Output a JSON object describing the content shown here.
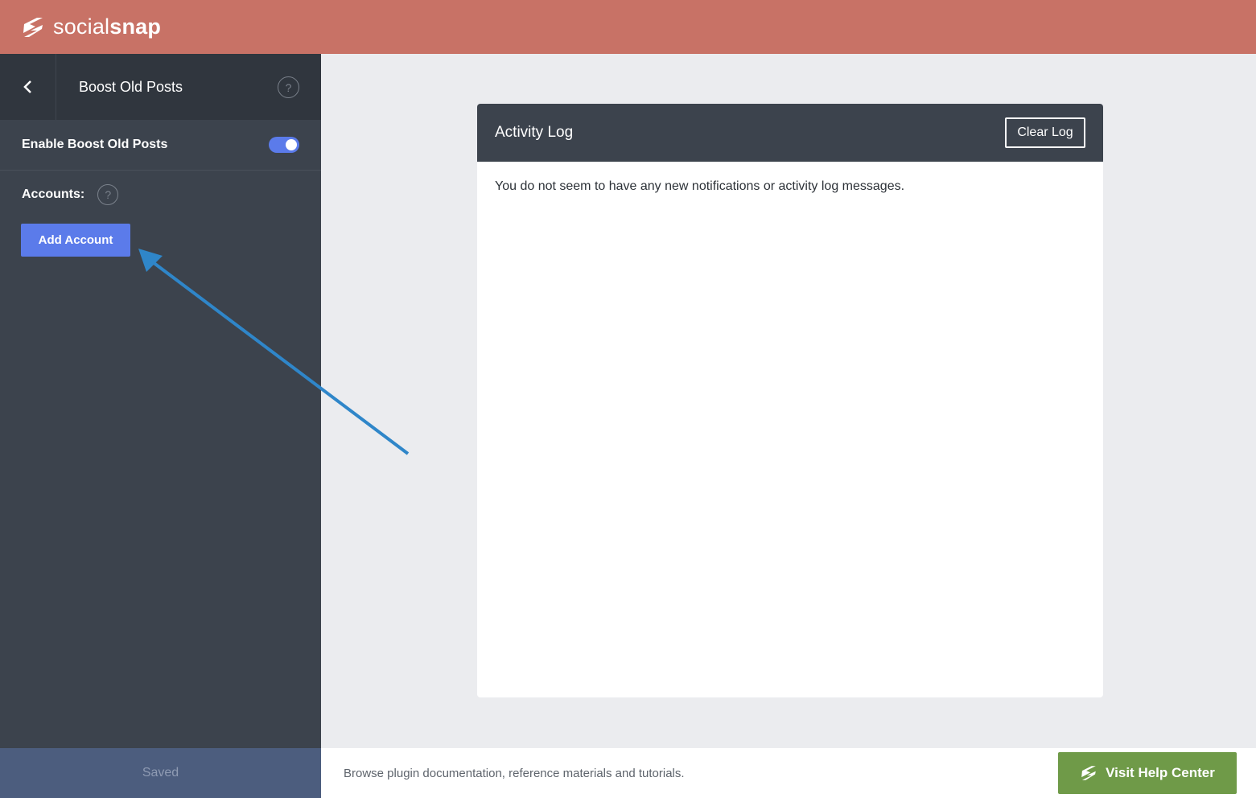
{
  "brand": {
    "name_light": "social",
    "name_bold": "snap",
    "color": "#c87266"
  },
  "sidebar": {
    "title": "Boost Old Posts",
    "enable_label": "Enable Boost Old Posts",
    "enable_on": true,
    "accounts_label": "Accounts:",
    "add_account_label": "Add Account",
    "help_glyph": "?",
    "saved_label": "Saved"
  },
  "activity_log": {
    "title": "Activity Log",
    "clear_label": "Clear Log",
    "message": "You do not seem to have any new notifications or activity log messages."
  },
  "footer": {
    "text": "Browse plugin documentation, reference materials and tutorials.",
    "help_button_label": "Visit Help Center"
  },
  "colors": {
    "accent": "#5b7bea",
    "help_button": "#6f9a48",
    "annotation_arrow": "#2f86c9",
    "sidebar": "#3c434d"
  },
  "icons": [
    "socialsnap-logo-icon",
    "chevron-left-icon",
    "help-circle-icon",
    "socialsnap-bolt-icon"
  ]
}
